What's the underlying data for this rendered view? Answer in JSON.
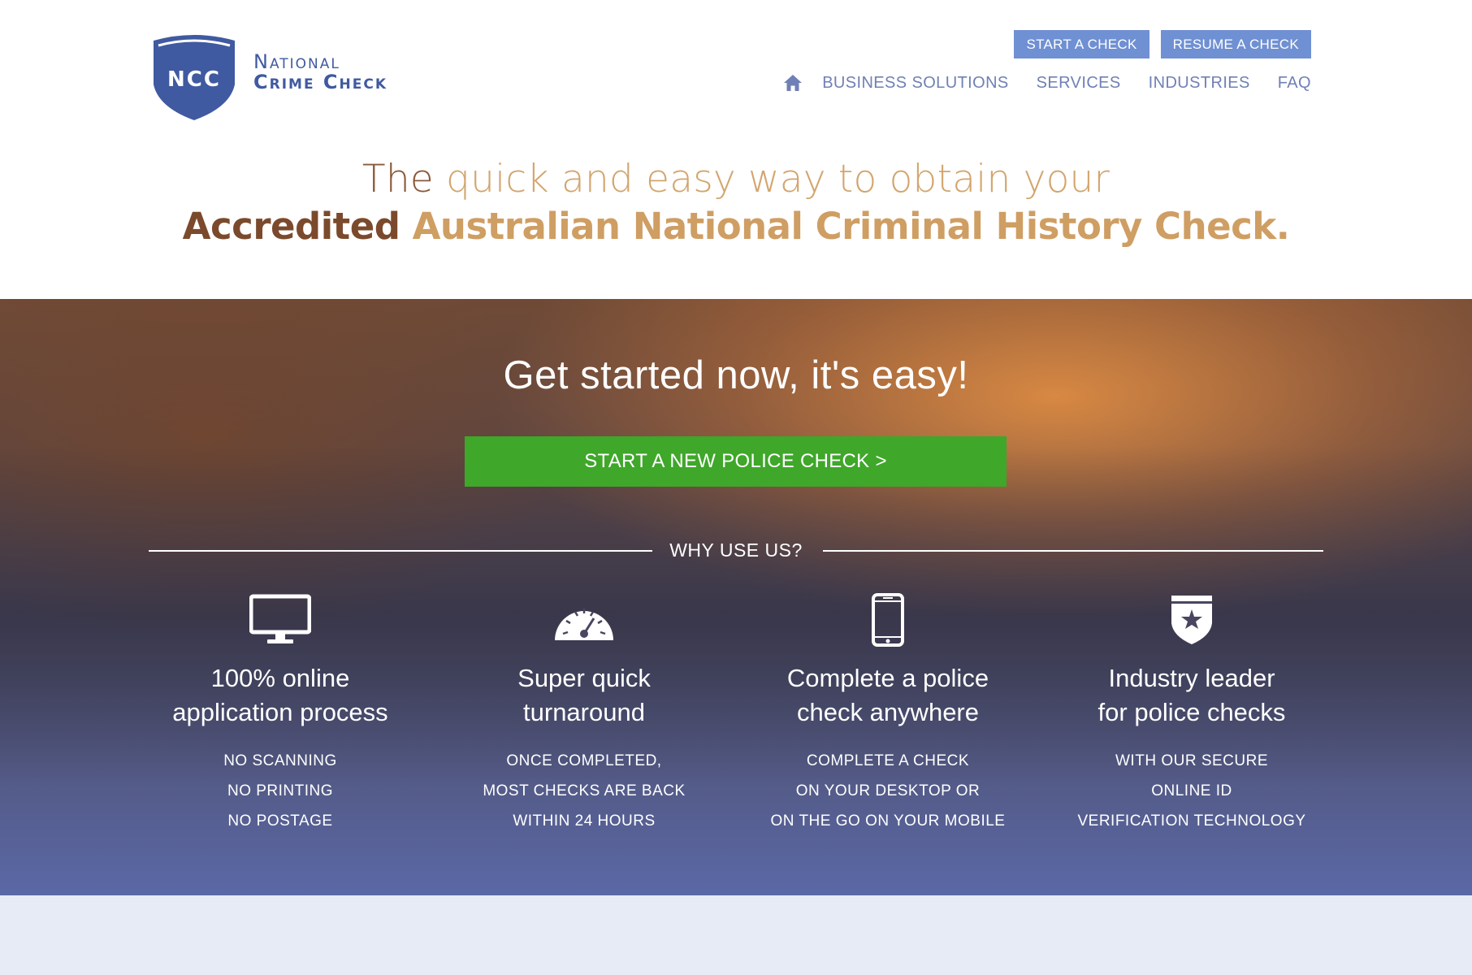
{
  "colors": {
    "accent_blue": "#6f90d3",
    "nav_text": "#6f80b6",
    "brand_blue": "#3f5aa0",
    "cta_green": "#3fa72a",
    "headline_gold": "#cf9e63",
    "headline_brown": "#7b4a2c",
    "footer_band": "#e7ebf6"
  },
  "logo": {
    "badge_text": "NCC",
    "line1": "National",
    "line2": "Crime Check"
  },
  "top_buttons": {
    "start": "START A CHECK",
    "resume": "RESUME A CHECK"
  },
  "nav": {
    "home_icon": "home-icon",
    "items": [
      "BUSINESS SOLUTIONS",
      "SERVICES",
      "INDUSTRIES",
      "FAQ"
    ]
  },
  "headline": {
    "line1_part1": "The",
    "line1_part2": " quick and easy way to obtain your",
    "line2_part1": "Accredited",
    "line2_part2": " Australian National Criminal History Check."
  },
  "hero": {
    "title": "Get started now, it's easy!",
    "cta": "START A NEW POLICE CHECK >",
    "why": "WHY USE US?"
  },
  "features": [
    {
      "icon": "monitor-icon",
      "title1": "100% online",
      "title2": "application process",
      "lines": [
        "NO SCANNING",
        "NO PRINTING",
        "NO POSTAGE"
      ]
    },
    {
      "icon": "speedometer-icon",
      "title1": "Super quick",
      "title2": "turnaround",
      "lines": [
        "ONCE COMPLETED,",
        "MOST CHECKS ARE BACK",
        "WITHIN 24 HOURS"
      ]
    },
    {
      "icon": "mobile-phone-icon",
      "title1": "Complete a police",
      "title2": "check anywhere",
      "lines": [
        "COMPLETE A CHECK",
        "ON YOUR DESKTOP OR",
        "ON THE GO ON YOUR MOBILE"
      ]
    },
    {
      "icon": "shield-star-icon",
      "title1": "Industry leader",
      "title2": "for police checks",
      "lines": [
        "WITH OUR SECURE",
        "ONLINE ID",
        "VERIFICATION TECHNOLOGY"
      ]
    }
  ]
}
